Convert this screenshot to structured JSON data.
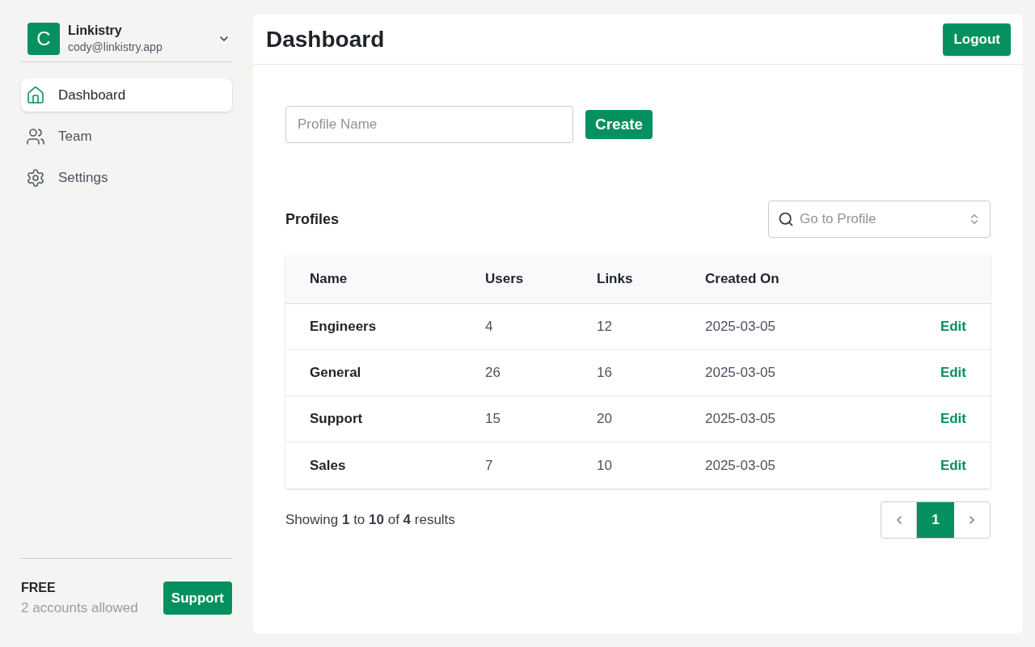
{
  "account": {
    "initial": "C",
    "name": "Linkistry",
    "email": "cody@linkistry.app"
  },
  "sidebar": {
    "items": [
      {
        "label": "Dashboard",
        "selected": true
      },
      {
        "label": "Team",
        "selected": false
      },
      {
        "label": "Settings",
        "selected": false
      }
    ]
  },
  "plan": {
    "name": "FREE",
    "note": "2 accounts allowed",
    "button": "Support"
  },
  "header": {
    "title": "Dashboard",
    "button": "Logout"
  },
  "create_form": {
    "placeholder": "Profile Name",
    "button": "Create"
  },
  "profiles": {
    "title": "Profiles",
    "search_placeholder": "Go to Profile"
  },
  "table": {
    "columns": [
      "Name",
      "Users",
      "Links",
      "Created On"
    ],
    "rows": [
      {
        "name": "Engineers",
        "users": "4",
        "links": "12",
        "created": "2025-03-05",
        "action": "Edit"
      },
      {
        "name": "General",
        "users": "26",
        "links": "16",
        "created": "2025-03-05",
        "action": "Edit"
      },
      {
        "name": "Support",
        "users": "15",
        "links": "20",
        "created": "2025-03-05",
        "action": "Edit"
      },
      {
        "name": "Sales",
        "users": "7",
        "links": "10",
        "created": "2025-03-05",
        "action": "Edit"
      }
    ]
  },
  "pagination": {
    "summary": "Showing **1** to **10** of **4** results",
    "pages": [
      {
        "label": "1",
        "selected": true
      }
    ]
  }
}
